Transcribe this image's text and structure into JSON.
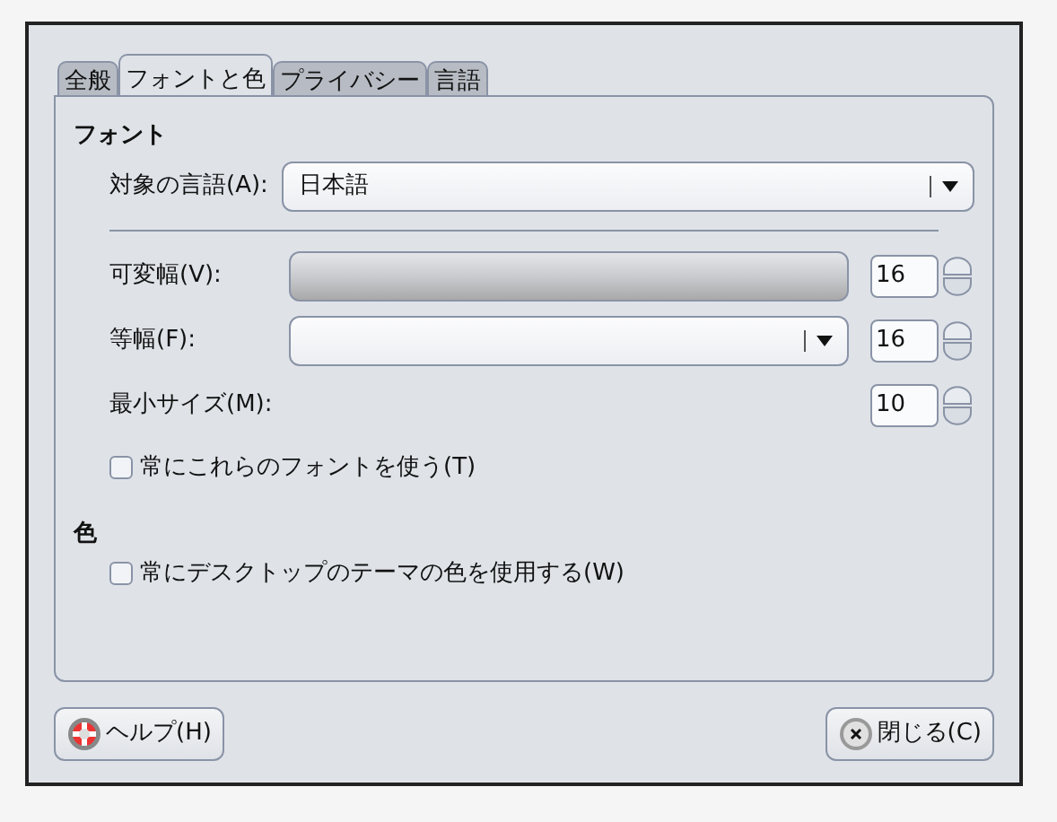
{
  "tabs": [
    {
      "label": "全般",
      "selected": false
    },
    {
      "label": "フォントと色",
      "selected": true
    },
    {
      "label": "プライバシー",
      "selected": false
    },
    {
      "label": "言語",
      "selected": false
    }
  ],
  "fonts": {
    "heading": "フォント",
    "language": {
      "label": "対象の言語(A):",
      "value": "日本語"
    },
    "rows": [
      {
        "kind": "combo",
        "label": "可変幅(V):",
        "disabled": true,
        "size": "16"
      },
      {
        "kind": "combo",
        "label": "等幅(F):",
        "disabled": false,
        "size": "16"
      },
      {
        "kind": "spin",
        "label": "最小サイズ(M):",
        "size": "10"
      }
    ],
    "always_use": {
      "label": "常にこれらのフォントを使う(T)",
      "checked": false
    }
  },
  "colors": {
    "heading": "色",
    "always_use": {
      "label": "常にデスクトップのテーマの色を使用する(W)",
      "checked": false
    }
  },
  "buttons": [
    {
      "kind": "help",
      "label": "ヘルプ(H)"
    },
    {
      "kind": "close",
      "label": "閉じる(C)"
    }
  ]
}
